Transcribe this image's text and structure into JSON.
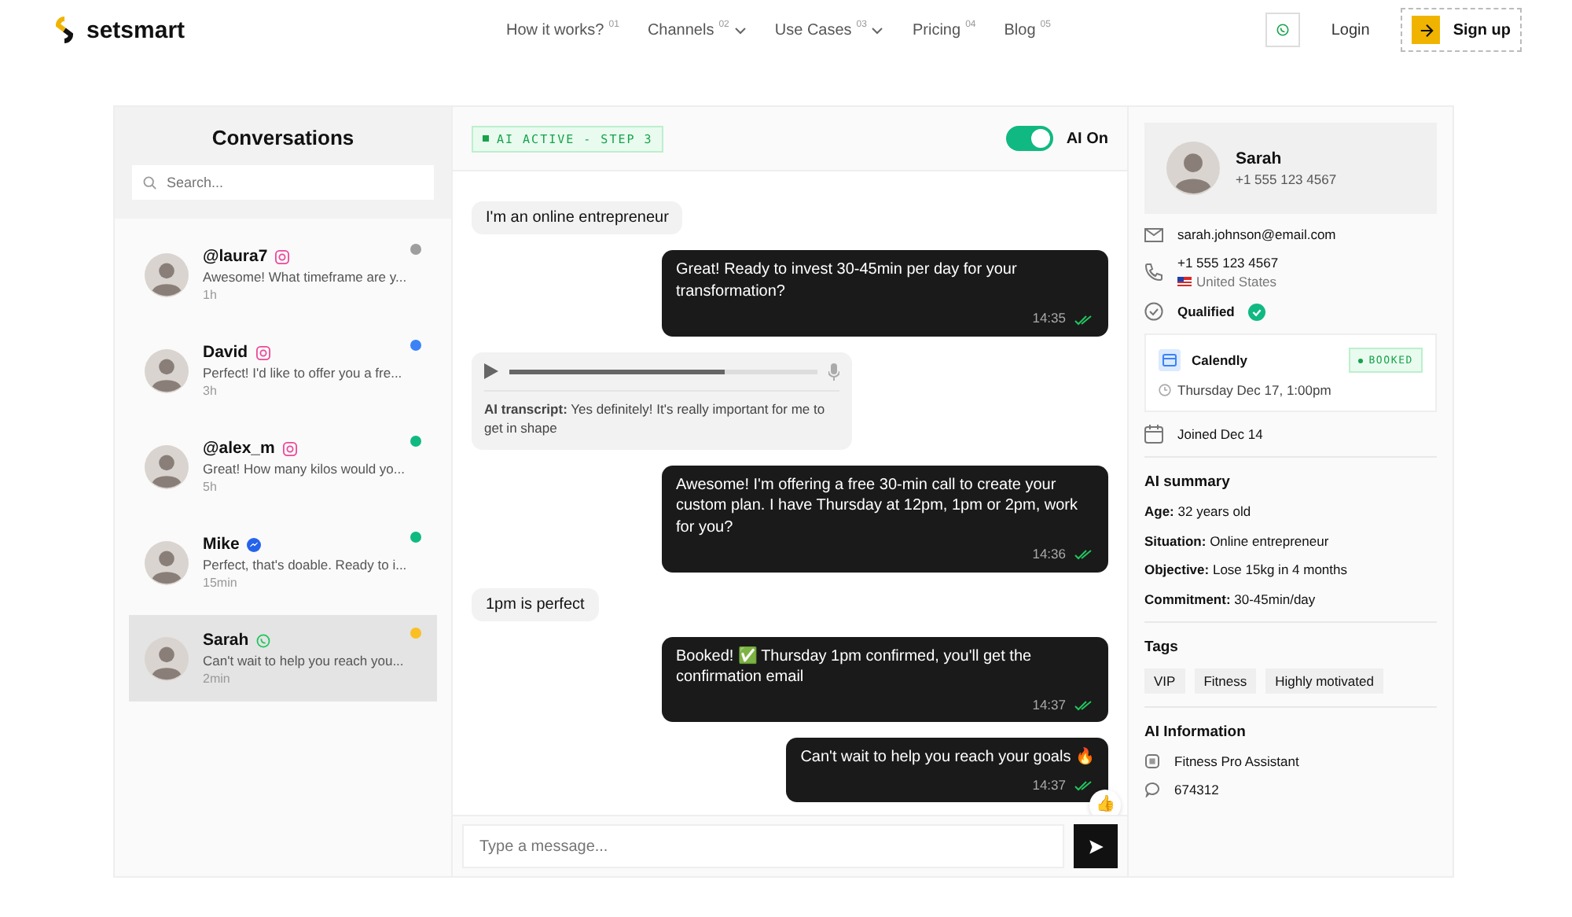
{
  "nav": {
    "logo": "setsmart",
    "links": [
      {
        "label": "How it works?",
        "index": "01",
        "dropdown": false
      },
      {
        "label": "Channels",
        "index": "02",
        "dropdown": true
      },
      {
        "label": "Use Cases",
        "index": "03",
        "dropdown": true
      },
      {
        "label": "Pricing",
        "index": "04",
        "dropdown": false
      },
      {
        "label": "Blog",
        "index": "05",
        "dropdown": false
      }
    ],
    "login": "Login",
    "signup": "Sign up"
  },
  "conversations": {
    "title": "Conversations",
    "search": {
      "placeholder": "Search..."
    },
    "items": [
      {
        "name": "@laura7",
        "kind": "instagram",
        "preview": "Awesome! What timeframe are y...",
        "time": "1h",
        "color": "#9e9e9e",
        "selected": false
      },
      {
        "name": "David",
        "kind": "instagram",
        "preview": "Perfect! I'd like to offer you a fre...",
        "time": "3h",
        "color": "#3b82f6",
        "selected": false
      },
      {
        "name": "@alex_m",
        "kind": "instagram",
        "preview": "Great! How many kilos would yo...",
        "time": "5h",
        "color": "#10b981",
        "selected": false
      },
      {
        "name": "Mike",
        "kind": "messenger",
        "preview": "Perfect, that's doable. Ready to i...",
        "time": "15min",
        "color": "#10b981",
        "selected": false
      },
      {
        "name": "Sarah",
        "kind": "whatsapp",
        "preview": "Can't wait to help you reach you...",
        "time": "2min",
        "color": "#fbbf24",
        "selected": true
      }
    ]
  },
  "chat": {
    "status": "AI ACTIVE - STEP 3",
    "ai_toggle": {
      "label": "AI On",
      "on": true
    },
    "messages": [
      {
        "kind": "incoming",
        "text": "I'm an online entrepreneur"
      },
      {
        "kind": "outgoing",
        "text": "Great! Ready to invest 30-45min per day for your transformation?",
        "time": "14:35",
        "read": true
      },
      {
        "kind": "voice",
        "level": 0.7,
        "transcript": "**AI transcript:** Yes definitely! It's really important for me to get in shape"
      },
      {
        "kind": "outgoing",
        "text": "Awesome! I'm offering a free 30-min call to create your custom plan. I have Thursday at 12pm, 1pm or 2pm, work for you?",
        "time": "14:36",
        "read": true
      },
      {
        "kind": "incoming",
        "text": "1pm is perfect"
      },
      {
        "kind": "outgoing",
        "text": "Booked! ✅ Thursday 1pm confirmed, you'll get the confirmation email",
        "time": "14:37",
        "read": true
      },
      {
        "kind": "outgoing",
        "text": "Can't wait to help you reach your goals 🔥",
        "time": "14:37",
        "read": true,
        "reaction": "👍"
      }
    ],
    "composer": {
      "placeholder": "Type a message..."
    }
  },
  "profile": {
    "name": "Sarah",
    "phone": "+1 555 123 4567",
    "email": "sarah.johnson@email.com",
    "contact_phone": "+1 555 123 4567",
    "country": "United States",
    "status": "Qualified",
    "booking": {
      "title": "Calendly",
      "badge": "BOOKED",
      "datetime": "Thursday Dec 17, 1:00pm"
    },
    "joined": "Joined Dec 14",
    "summary_title": "AI summary",
    "summary": [
      "**Age:** 32 years old",
      "**Situation:** Online entrepreneur",
      "**Objective:** Lose 15kg in 4 months",
      "**Commitment:** 30-45min/day"
    ],
    "tags_title": "Tags",
    "tags": [
      "VIP",
      "Fitness",
      "Highly motivated"
    ],
    "ai_title": "AI Information",
    "ai_items": [
      {
        "kind": "assistant",
        "text": "Fitness Pro Assistant"
      },
      {
        "kind": "id",
        "text": "674312"
      }
    ]
  }
}
